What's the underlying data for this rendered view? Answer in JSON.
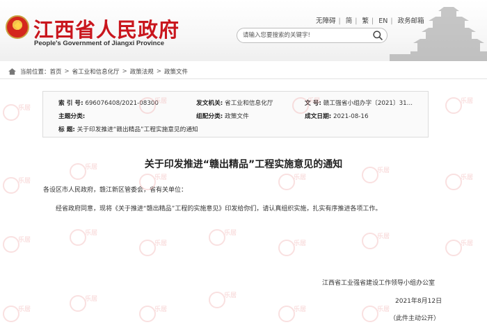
{
  "header": {
    "site_title": "江西省人民政府",
    "site_title_en": "People's Government of Jiangxi Province",
    "top_links": [
      "无障碍",
      "简",
      "繁",
      "EN",
      "政务邮箱"
    ],
    "search_placeholder": "请输入您要搜索的关键字!"
  },
  "breadcrumb": {
    "label": "当前位置：",
    "items": [
      "首页",
      "省工业和信息化厅",
      "政策法规",
      "政策文件"
    ]
  },
  "meta": {
    "index_key": "索  引  号:",
    "index_val": "696076408/2021-08300",
    "issuer_key": "发文机关:",
    "issuer_val": "省工业和信息化厅",
    "docno_key": "文         号:",
    "docno_val": "赣工强省小组办字〔2021〕31...",
    "subject_key": "主题分类:",
    "subject_val": "",
    "category_key": "组配分类:",
    "category_val": "政策文件",
    "date_key": "成文日期:",
    "date_val": "2021-08-16",
    "title_key": "标        题:",
    "title_val": "关于印发推进“赣出精品”工程实施意见的通知"
  },
  "article": {
    "title": "关于印发推进“赣出精品”工程实施意见的通知",
    "salutation": "各设区市人民政府，赣江新区管委会，省有关单位：",
    "body": "经省政府同意，现将《关于推进“赣出精品”工程的实施意见》印发给你们，请认真组织实施，扎实有序推进各项工作。",
    "signature": "江西省工业强省建设工作领导小组办公室",
    "date": "2021年8月12日",
    "note": "（此件主动公开）"
  },
  "watermark_text": "乐居",
  "colors": {
    "brand_red": "#c9161d",
    "watermark": "#f0a7a7"
  }
}
